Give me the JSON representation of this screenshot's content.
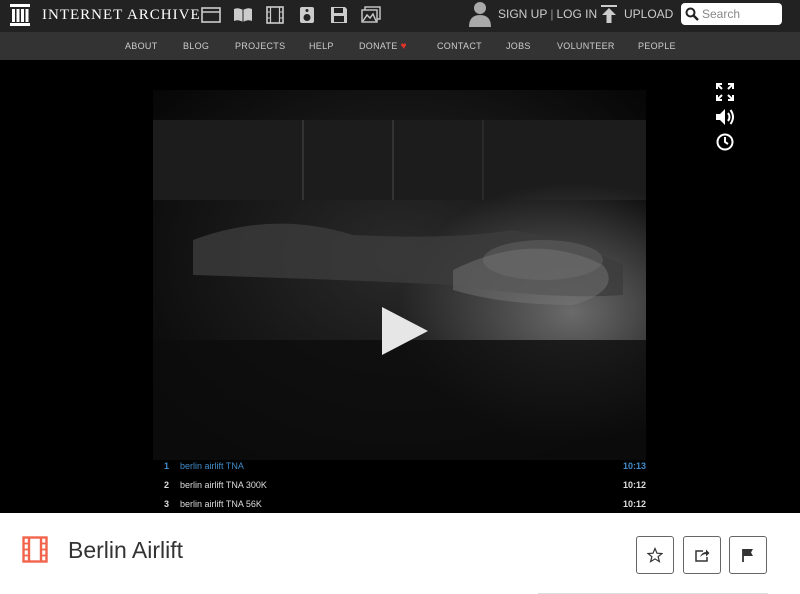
{
  "header": {
    "logo_text": "INTERNET ARCHIVE",
    "media_icons": [
      "web-icon",
      "texts-icon",
      "video-icon",
      "audio-icon",
      "software-icon",
      "images-icon"
    ],
    "signup_label": "SIGN UP",
    "separator": "|",
    "login_label": "LOG IN",
    "upload_label": "UPLOAD",
    "search_placeholder": "Search"
  },
  "nav": {
    "items": [
      "ABOUT",
      "BLOG",
      "PROJECTS",
      "HELP",
      "DONATE",
      "CONTACT",
      "JOBS",
      "VOLUNTEER",
      "PEOPLE"
    ],
    "donate_icon": "heart-icon",
    "heart_color": "#e3332a"
  },
  "player": {
    "controls": [
      "fullscreen-icon",
      "volume-icon",
      "clock-icon"
    ],
    "playlist": [
      {
        "num": "1",
        "title": "berlin airlift TNA",
        "duration": "10:13",
        "active": true
      },
      {
        "num": "2",
        "title": "berlin airlift TNA 300K",
        "duration": "10:12",
        "active": false
      },
      {
        "num": "3",
        "title": "berlin airlift TNA 56K",
        "duration": "10:12",
        "active": false
      }
    ]
  },
  "item": {
    "title": "Berlin Airlift",
    "type_icon": "film-icon",
    "type_color": "#f1644b",
    "actions": [
      "favorite-icon",
      "share-icon",
      "flag-icon"
    ]
  },
  "colors": {
    "topbar": "#222222",
    "navbar": "#333333",
    "active_track": "#428bca"
  }
}
